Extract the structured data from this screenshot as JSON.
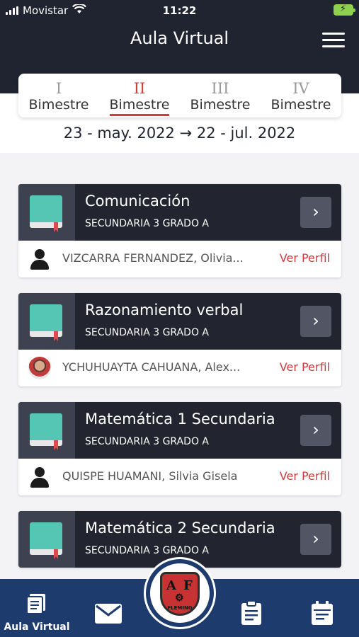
{
  "status_bar": {
    "carrier": "Movistar",
    "time": "11:22"
  },
  "header": {
    "title": "Aula Virtual"
  },
  "terms": [
    {
      "roman": "I",
      "label": "Bimestre",
      "active": false
    },
    {
      "roman": "II",
      "label": "Bimestre",
      "active": true
    },
    {
      "roman": "III",
      "label": "Bimestre",
      "active": false
    },
    {
      "roman": "IV",
      "label": "Bimestre",
      "active": false
    }
  ],
  "date_range": "23 - may. 2022 → 22 - jul. 2022",
  "courses": [
    {
      "name": "Comunicación",
      "grade": "SECUNDARIA 3 GRADO A",
      "teacher": "VIZCARRA FERNANDEZ, Olivia...",
      "link": "Ver Perfil",
      "avatar": "person-icon"
    },
    {
      "name": "Razonamiento verbal",
      "grade": "SECUNDARIA 3 GRADO A",
      "teacher": "YCHUHUAYTA CAHUANA, Alex...",
      "link": "Ver Perfil",
      "avatar": "teacher-photo"
    },
    {
      "name": "Matemática 1 Secundaria",
      "grade": "SECUNDARIA 3 GRADO A",
      "teacher": "QUISPE HUAMANI, Silvia Gisela",
      "link": "Ver Perfil",
      "avatar": "person-icon"
    },
    {
      "name": "Matemática 2 Secundaria",
      "grade": "SECUNDARIA 3 GRADO A",
      "teacher": "",
      "link": "",
      "avatar": ""
    }
  ],
  "bottom_nav": {
    "items": [
      {
        "label": "Aula Virtual",
        "icon": "notebook-icon"
      },
      {
        "label": "",
        "icon": "mail-icon"
      },
      {
        "label": "",
        "icon": "school-crest-logo"
      },
      {
        "label": "",
        "icon": "clipboard-icon"
      },
      {
        "label": "",
        "icon": "calendar-icon"
      }
    ],
    "crest_text": "FLEMING"
  },
  "colors": {
    "header_bg": "#1f2430",
    "accent": "#d23b3b",
    "nav_bg": "#1e3b6e",
    "book_cover": "#55c5b4"
  }
}
